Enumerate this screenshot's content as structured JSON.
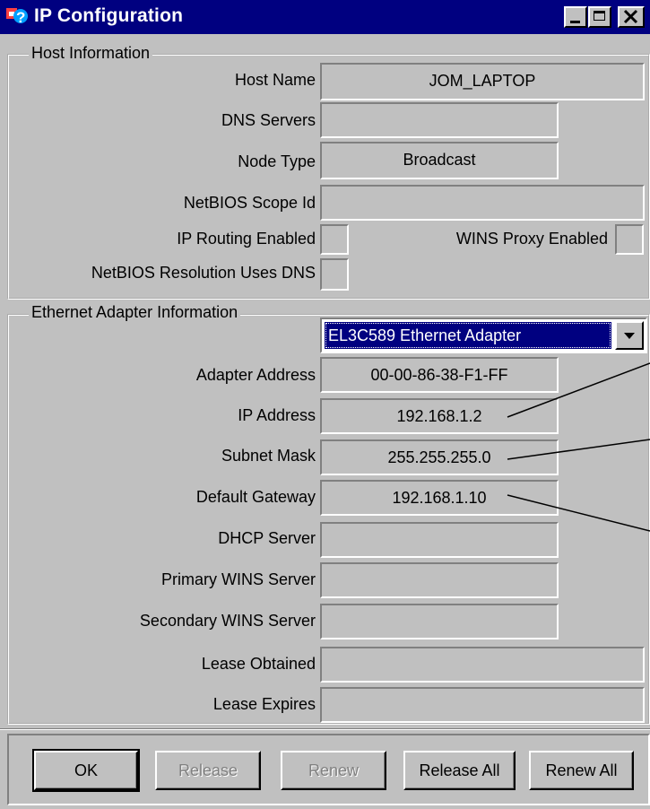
{
  "window": {
    "title": "IP Configuration"
  },
  "host": {
    "group_label": "Host Information",
    "host_name_label": "Host Name",
    "host_name": "JOM_LAPTOP",
    "dns_servers_label": "DNS Servers",
    "dns_servers": "",
    "node_type_label": "Node Type",
    "node_type": "Broadcast",
    "scope_label": "NetBIOS Scope Id",
    "scope": "",
    "ip_routing_label": "IP Routing Enabled",
    "wins_proxy_label": "WINS Proxy Enabled",
    "netbios_dns_label": "NetBIOS Resolution Uses DNS"
  },
  "adapter": {
    "group_label": "Ethernet  Adapter Information",
    "selected": "EL3C589 Ethernet Adapter",
    "address_label": "Adapter Address",
    "address": "00-00-86-38-F1-FF",
    "ip_label": "IP Address",
    "ip": "192.168.1.2",
    "subnet_label": "Subnet Mask",
    "subnet": "255.255.255.0",
    "gateway_label": "Default Gateway",
    "gateway": "192.168.1.10",
    "dhcp_label": "DHCP Server",
    "dhcp": "",
    "primary_wins_label": "Primary WINS Server",
    "primary_wins": "",
    "secondary_wins_label": "Secondary WINS Server",
    "secondary_wins": "",
    "lease_obtained_label": "Lease Obtained",
    "lease_obtained": "",
    "lease_expires_label": "Lease Expires",
    "lease_expires": ""
  },
  "buttons": {
    "ok": "OK",
    "release": "Release",
    "renew": "Renew",
    "release_all": "Release All",
    "renew_all": "Renew All"
  },
  "icons": {
    "app": "network-question-icon",
    "minimize": "minimize-icon",
    "maximize": "maximize-icon",
    "close": "close-icon",
    "dropdown": "chevron-down-icon"
  },
  "colors": {
    "titlebar": "#000080",
    "face": "#c0c0c0",
    "selection": "#000080"
  }
}
